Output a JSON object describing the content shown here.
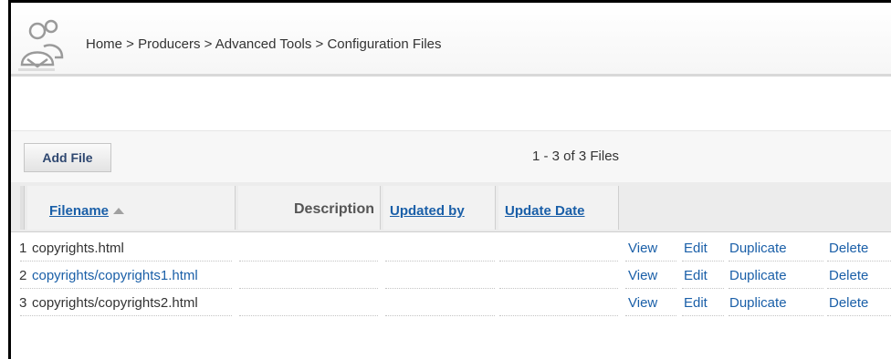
{
  "header": {
    "breadcrumb": "Home > Producers > Advanced Tools > Configuration Files",
    "logo_icon": "users-icon"
  },
  "toolbar": {
    "add_file_label": "Add File",
    "count_text": "1 - 3 of 3 Files"
  },
  "table": {
    "columns": {
      "filename": "Filename",
      "description": "Description",
      "updated_by": "Updated by",
      "update_date": "Update Date"
    },
    "sort_indicator_icon": "sort-ascending-icon",
    "rows": [
      {
        "index": "1",
        "filename": "copyrights.html",
        "filename_is_link": false
      },
      {
        "index": "2",
        "filename": "copyrights/copyrights1.html",
        "filename_is_link": true
      },
      {
        "index": "3",
        "filename": "copyrights/copyrights2.html",
        "filename_is_link": false
      }
    ],
    "actions": {
      "view": "View",
      "edit": "Edit",
      "duplicate": "Duplicate",
      "delete": "Delete"
    }
  },
  "colors": {
    "link": "#1a5fa8",
    "text": "#333333",
    "header_bg": "#f2f2f2"
  }
}
